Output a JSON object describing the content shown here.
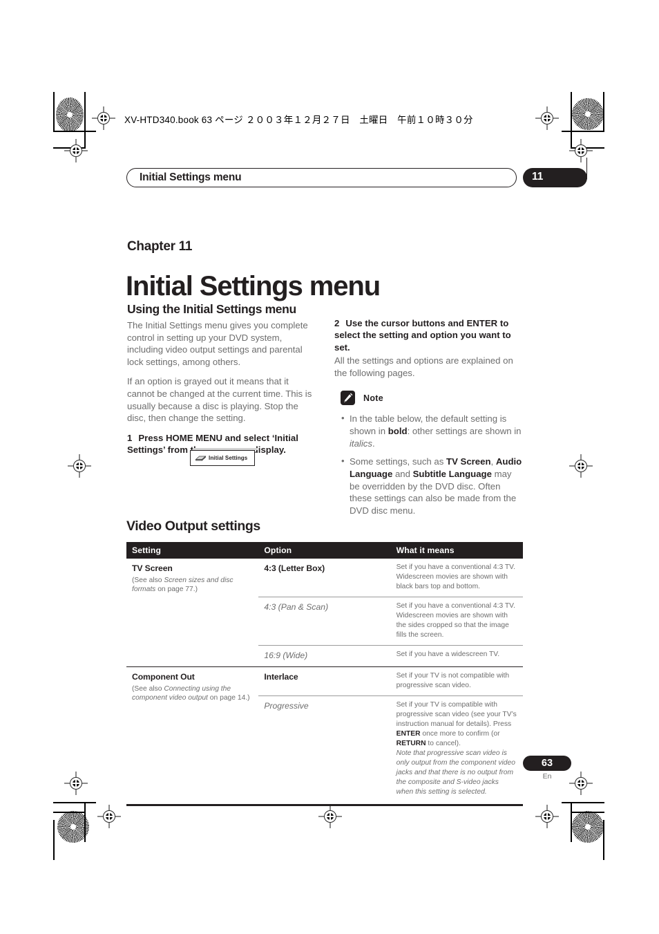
{
  "print_marks": {
    "file_header": "XV-HTD340.book  63 ページ  ２００３年１２月２７日　土曜日　午前１０時３０分"
  },
  "running_head": {
    "title": "Initial Settings menu",
    "chapter_tab": "11"
  },
  "chapter": {
    "label": "Chapter 11",
    "title": "Initial Settings menu"
  },
  "left_column": {
    "section_heading": "Using the Initial Settings menu",
    "paragraph_1": "The Initial Settings menu gives you complete control in setting up your DVD system, including video output settings and parental lock settings, among others.",
    "paragraph_2": "If an option is grayed out it means that it cannot be changed at the current time. This is usually because a disc is playing. Stop the disc, then change the setting.",
    "step_1_number": "1",
    "step_1_text": "Press HOME MENU and select ‘Initial Settings’ from the on-screen display.",
    "osd_graphic_label": "Initial Settings"
  },
  "right_column": {
    "step_2_number": "2",
    "step_2_text": "Use the cursor buttons and ENTER to select the setting and option you want to set.",
    "step_2_body": "All the settings and options are explained on the following pages.",
    "note_label": "Note",
    "note_bullets": [
      {
        "parts": [
          {
            "t": "In the table below, the default setting is shown in ",
            "s": "normal"
          },
          {
            "t": "bold",
            "s": "bold"
          },
          {
            "t": ": other settings are shown in ",
            "s": "normal"
          },
          {
            "t": "italics",
            "s": "italic"
          },
          {
            "t": ".",
            "s": "normal"
          }
        ]
      },
      {
        "parts": [
          {
            "t": "Some settings, such as ",
            "s": "normal"
          },
          {
            "t": "TV Screen",
            "s": "bold"
          },
          {
            "t": ", ",
            "s": "normal"
          },
          {
            "t": "Audio Language",
            "s": "bold"
          },
          {
            "t": " and ",
            "s": "normal"
          },
          {
            "t": "Subtitle Language",
            "s": "bold"
          },
          {
            "t": " may be overridden by the DVD disc. Often these settings can also be made from the DVD disc menu.",
            "s": "normal"
          }
        ]
      }
    ]
  },
  "table_section": {
    "heading": "Video Output settings",
    "columns": [
      "Setting",
      "Option",
      "What it means"
    ],
    "groups": [
      {
        "setting_name": "TV Screen",
        "setting_ref_parts": [
          {
            "t": "(See also ",
            "s": "normal"
          },
          {
            "t": "Screen sizes and disc formats",
            "s": "italic"
          },
          {
            "t": " on page 77.)",
            "s": "normal"
          }
        ],
        "rows": [
          {
            "option": "4:3 (Letter Box)",
            "option_style": "bold",
            "means_parts": [
              {
                "t": "Set if you have a conventional 4:3 TV. Widescreen movies are shown with black bars top and bottom.",
                "s": "normal"
              }
            ]
          },
          {
            "option": "4:3 (Pan & Scan)",
            "option_style": "italic",
            "means_parts": [
              {
                "t": "Set if you have a conventional 4:3 TV. Widescreen movies are shown with the sides cropped so that the image fills the screen.",
                "s": "normal"
              }
            ]
          },
          {
            "option": "16:9 (Wide)",
            "option_style": "italic",
            "means_parts": [
              {
                "t": "Set if you have a widescreen TV.",
                "s": "normal"
              }
            ]
          }
        ]
      },
      {
        "setting_name": "Component Out",
        "setting_ref_parts": [
          {
            "t": "(See also ",
            "s": "normal"
          },
          {
            "t": "Connecting using the component video output",
            "s": "italic"
          },
          {
            "t": " on page 14.)",
            "s": "normal"
          }
        ],
        "rows": [
          {
            "option": "Interlace",
            "option_style": "bold",
            "means_parts": [
              {
                "t": "Set if your TV is not compatible with progressive scan video.",
                "s": "normal"
              }
            ]
          },
          {
            "option": "Progressive",
            "option_style": "italic",
            "means_parts": [
              {
                "t": "Set if your TV is compatible with progressive scan video (see your TV’s instruction manual for details). Press ",
                "s": "normal"
              },
              {
                "t": "ENTER",
                "s": "bold"
              },
              {
                "t": " once more to confirm (or ",
                "s": "normal"
              },
              {
                "t": "RETURN",
                "s": "bold"
              },
              {
                "t": " to cancel).",
                "s": "normal"
              },
              {
                "t": "Note that progressive scan video is only output from the component video jacks and that there is no output from the composite and S-video jacks when this setting is selected.",
                "s": "italic-block"
              }
            ]
          }
        ]
      }
    ]
  },
  "footer": {
    "page_number": "63",
    "language_code": "En"
  },
  "colors": {
    "ink_black": "#231f20",
    "body_gray": "#6d6d6d",
    "rule_gray": "#9b9b9b"
  }
}
